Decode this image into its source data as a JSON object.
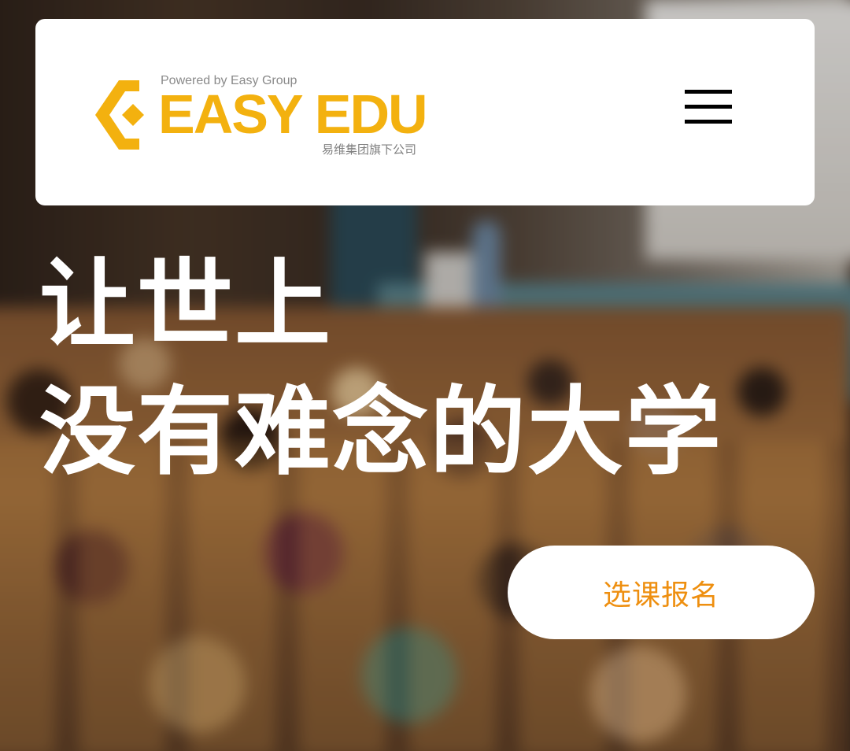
{
  "header": {
    "logo": {
      "powered_by": "Powered by Easy Group",
      "brand": "EASY EDU",
      "subtitle": "易维集团旗下公司",
      "brand_color": "#F3B10F"
    },
    "menu_icon": "hamburger-menu-icon"
  },
  "hero": {
    "headline_line1": "让世上",
    "headline_line2": "没有难念的大学",
    "cta_label": "选课报名",
    "cta_color": "#EE8F10"
  }
}
